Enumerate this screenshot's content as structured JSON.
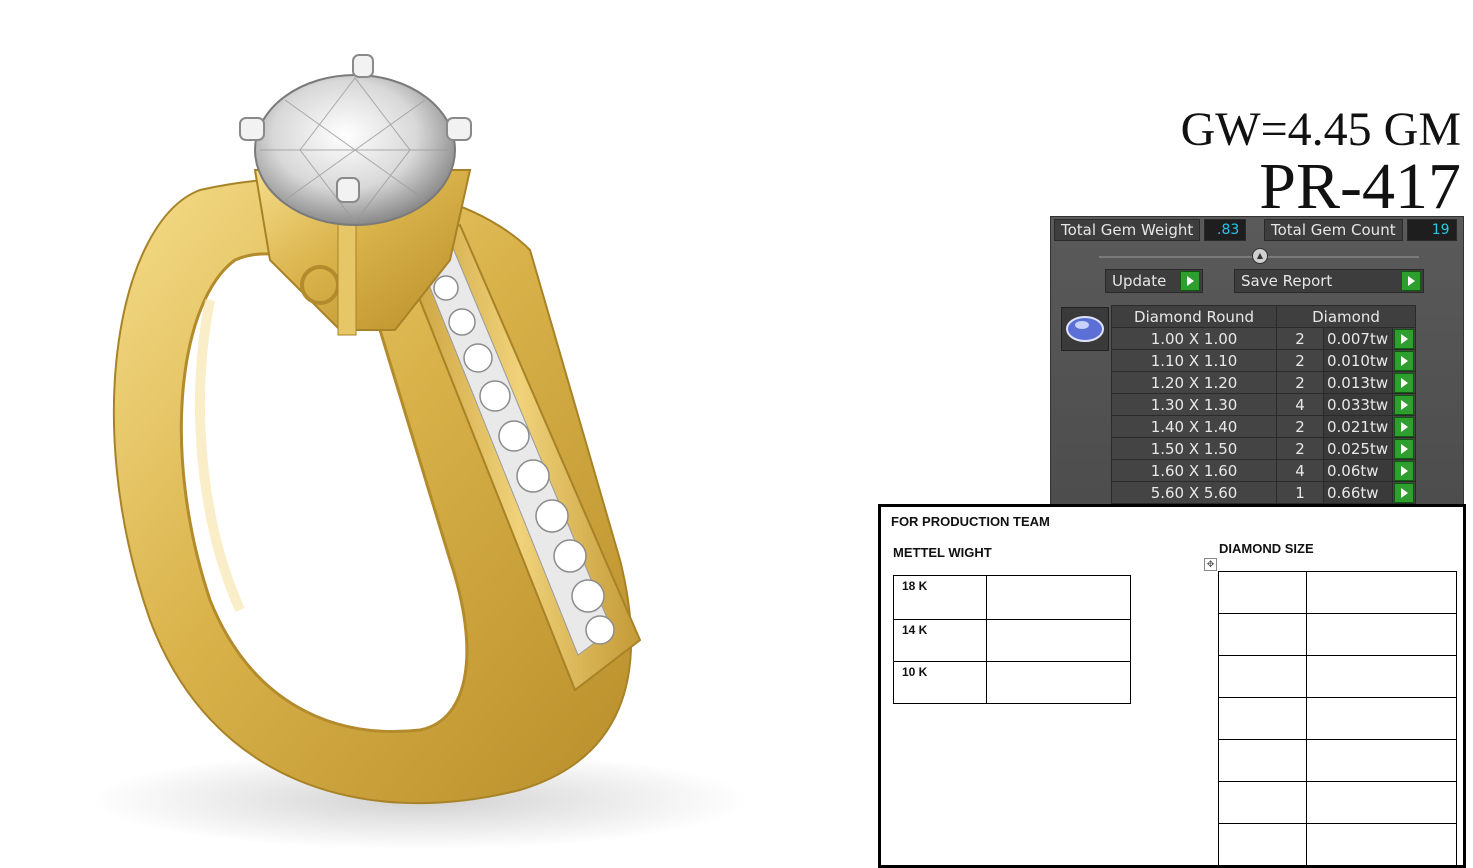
{
  "heading": {
    "gross_weight": "GW=4.45 GM",
    "product_code": "PR-417"
  },
  "gem_panel": {
    "total_gem_weight_label": "Total Gem Weight",
    "total_gem_weight_value": ".83",
    "total_gem_count_label": "Total Gem Count",
    "total_gem_count_value": "19",
    "update_label": "Update",
    "save_report_label": "Save Report",
    "table_header": {
      "shape": "Diamond Round",
      "type": "Diamond"
    },
    "rows": [
      {
        "size": "1.00 X 1.00",
        "count": "2",
        "weight": "0.007tw"
      },
      {
        "size": "1.10 X 1.10",
        "count": "2",
        "weight": "0.010tw"
      },
      {
        "size": "1.20 X 1.20",
        "count": "2",
        "weight": "0.013tw"
      },
      {
        "size": "1.30 X 1.30",
        "count": "4",
        "weight": "0.033tw"
      },
      {
        "size": "1.40 X 1.40",
        "count": "2",
        "weight": "0.021tw"
      },
      {
        "size": "1.50 X 1.50",
        "count": "2",
        "weight": "0.025tw"
      },
      {
        "size": "1.60 X 1.60",
        "count": "4",
        "weight": "0.06tw"
      },
      {
        "size": "5.60 X 5.60",
        "count": "1",
        "weight": "0.66tw"
      }
    ]
  },
  "production_sheet": {
    "title": "FOR PRODUCTION TEAM",
    "metal_weight_title": "METTEL WIGHT",
    "diamond_size_title": "DIAMOND SIZE",
    "karats": [
      "18 K",
      "14 K",
      "10 K"
    ]
  },
  "colors": {
    "gold": "#e3c25a",
    "panel_bg": "#4f4f4f",
    "value_text": "#27c7e8",
    "go_button": "#2e9e2e"
  }
}
